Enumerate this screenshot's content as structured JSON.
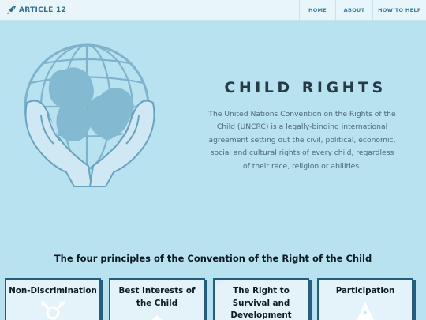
{
  "nav": {
    "brand": "ARTICLE 12",
    "links": [
      "HOME",
      "ABOUT",
      "HOW TO HELP"
    ]
  },
  "hero": {
    "title": "CHILD RIGHTS",
    "description": "The United Nations Convention on the Rights of the Child (UNCRC) is a legally-binding international agreement setting out the civil, political, economic, social and cultural rights of every child, regardless of their race, religion or abilities."
  },
  "principles": {
    "heading": "The four principles of the Convention of the Right of the Child",
    "cards": [
      {
        "title": "Non-Discrimination",
        "icon": "gender-symbols-icon"
      },
      {
        "title": "Best Interests of the Child",
        "icon": "house-icon"
      },
      {
        "title": "The Right to Survival and Development",
        "icon": ""
      },
      {
        "title": "Participation",
        "icon": "hand-raise-icon"
      }
    ]
  },
  "colors": {
    "background": "#b8e2f0",
    "nav_background": "#e8f6fb",
    "accent": "#235e80"
  }
}
